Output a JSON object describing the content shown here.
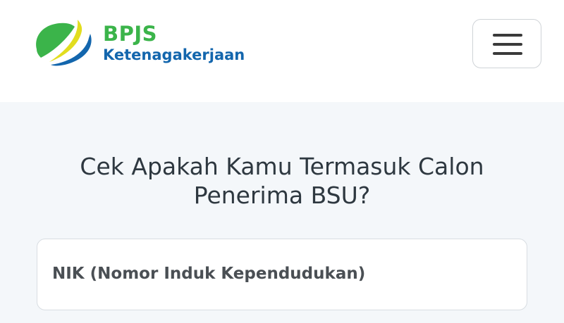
{
  "header": {
    "brand_name": "BPJS",
    "brand_subtitle": "Ketenagakerjaan",
    "menu_icon": "hamburger-menu-icon"
  },
  "main": {
    "headline_line1": "Cek Apakah Kamu Termasuk Calon",
    "headline_line2": "Penerima BSU?",
    "nik_field_label": "NIK (Nomor Induk Kependudukan)"
  },
  "colors": {
    "brand_green": "#3bb44a",
    "brand_blue": "#1366ad",
    "brand_yellow": "#e2dd1e",
    "page_background": "#f4f7fa"
  }
}
